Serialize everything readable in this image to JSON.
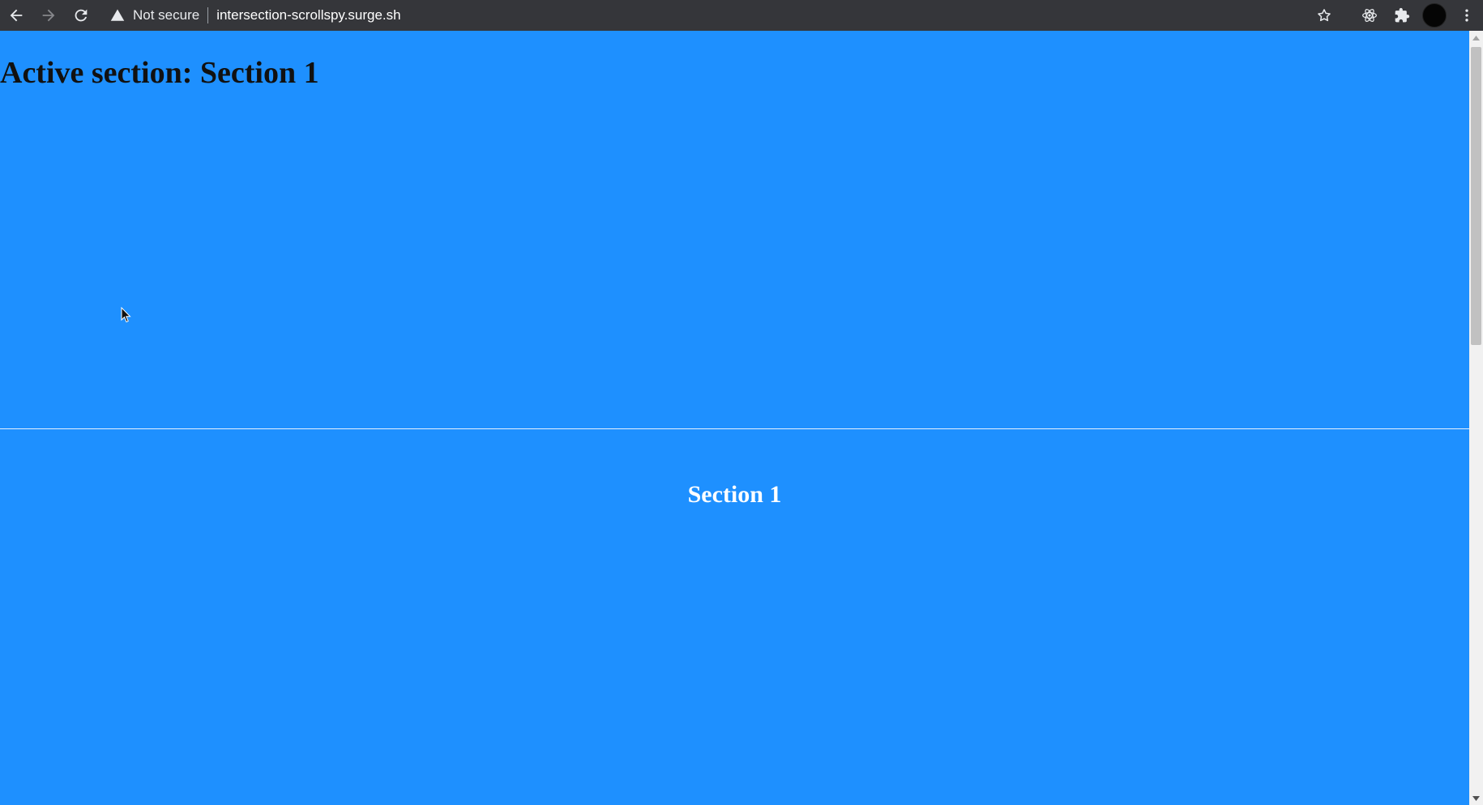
{
  "browser": {
    "security_label": "Not secure",
    "url": "intersection-scrollspy.surge.sh"
  },
  "page": {
    "active_heading": "Active section: Section 1",
    "section_title": "Section 1",
    "background_color": "#1e90ff"
  },
  "icons": {
    "back": "back-arrow-icon",
    "forward": "forward-arrow-icon",
    "reload": "reload-icon",
    "warning": "warning-icon",
    "bookmark": "star-icon",
    "react_devtools": "react-icon",
    "extensions": "puzzle-icon",
    "menu": "kebab-menu-icon"
  },
  "scrollbar": {
    "scroll_position": 0.0
  }
}
